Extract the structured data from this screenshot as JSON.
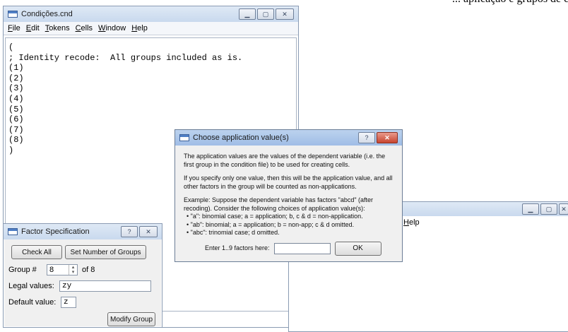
{
  "banner_text": "... aplicação e grupos de condições ...",
  "main_window": {
    "title": "Condições.cnd",
    "menu": [
      "File",
      "Edit",
      "Tokens",
      "Cells",
      "Window",
      "Help"
    ],
    "lines": [
      "(",
      "; Identity recode:  All groups included as is.",
      "(1)",
      "(2)",
      "(3)",
      "(4)",
      "(5)",
      "(6)",
      "(7)",
      "(8)",
      ")"
    ]
  },
  "second_window": {
    "menu_help": "Help"
  },
  "dialog": {
    "title": "Choose application value(s)",
    "help_glyph": "?",
    "close_glyph": "✕",
    "para1": "The application values are the values of the dependent variable (i.e. the first group in the condition file) to be used for creating cells.",
    "para2": "If you specify only one value, then this will be the application value, and all other factors in the group will be counted as non-applications.",
    "example_intro": "Example: Suppose the dependent variable has factors \"abcd\" (after recoding). Consider the following choices of application value(s):",
    "bullets": [
      "• \"a\": binomial case; a = application; b, c & d = non-application.",
      "• \"ab\": binomial; a = application; b = non-app; c & d omitted.",
      "• \"abc\": trinomial case; d omitted."
    ],
    "entry_label": "Enter 1..9 factors here:",
    "entry_value": "",
    "ok_label": "OK"
  },
  "factor_spec": {
    "title": "Factor Specification",
    "help_glyph": "?",
    "check_all_label": "Check All",
    "set_groups_label": "Set Number of Groups",
    "group_label": "Group #",
    "group_value": "8",
    "of_label": "of 8",
    "legal_label": "Legal values:",
    "legal_value": "zy",
    "default_label": "Default value:",
    "default_value": "z",
    "modify_label": "Modify Group"
  }
}
